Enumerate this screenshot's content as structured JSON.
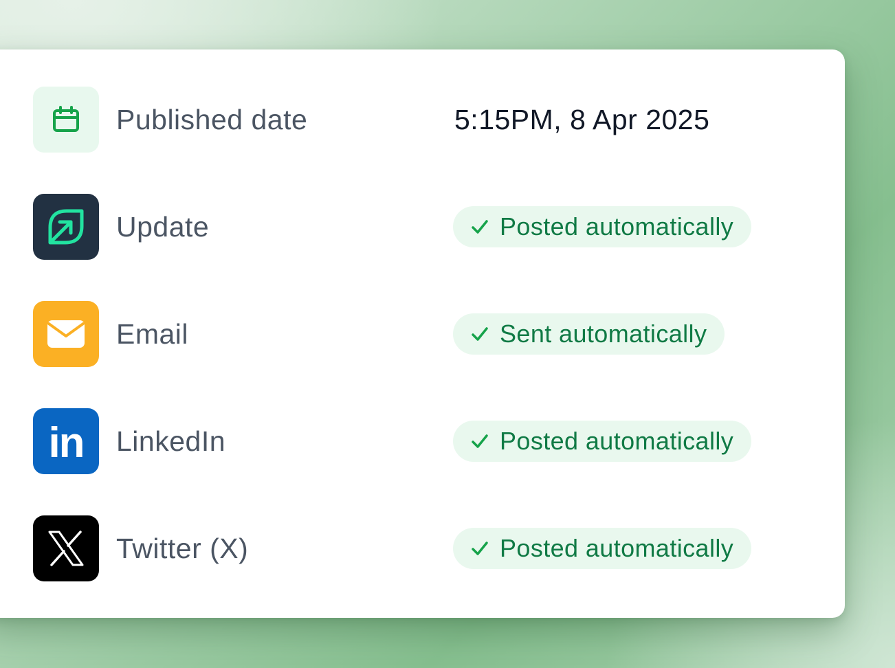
{
  "rows": [
    {
      "label": "Published date",
      "value": "5:15PM, 8 Apr 2025",
      "icon": "calendar-icon"
    },
    {
      "label": "Update",
      "status": "Posted automatically",
      "icon": "update-leaf-icon"
    },
    {
      "label": "Email",
      "status": "Sent automatically",
      "icon": "envelope-icon"
    },
    {
      "label": "LinkedIn",
      "status": "Posted automatically",
      "icon": "linkedin-icon",
      "icon_text": "in"
    },
    {
      "label": "Twitter (X)",
      "status": "Posted automatically",
      "icon": "x-logo-icon"
    }
  ],
  "colors": {
    "calendar_bg": "#e8f8ee",
    "calendar_fg": "#16a34a",
    "update_bg": "#223142",
    "update_fg": "#22e3a0",
    "email_bg": "#fbb024",
    "linkedin_bg": "#0a66c2",
    "twitter_bg": "#000000",
    "badge_bg": "#e9f8ee",
    "badge_text": "#107a45",
    "check": "#16a34a"
  }
}
